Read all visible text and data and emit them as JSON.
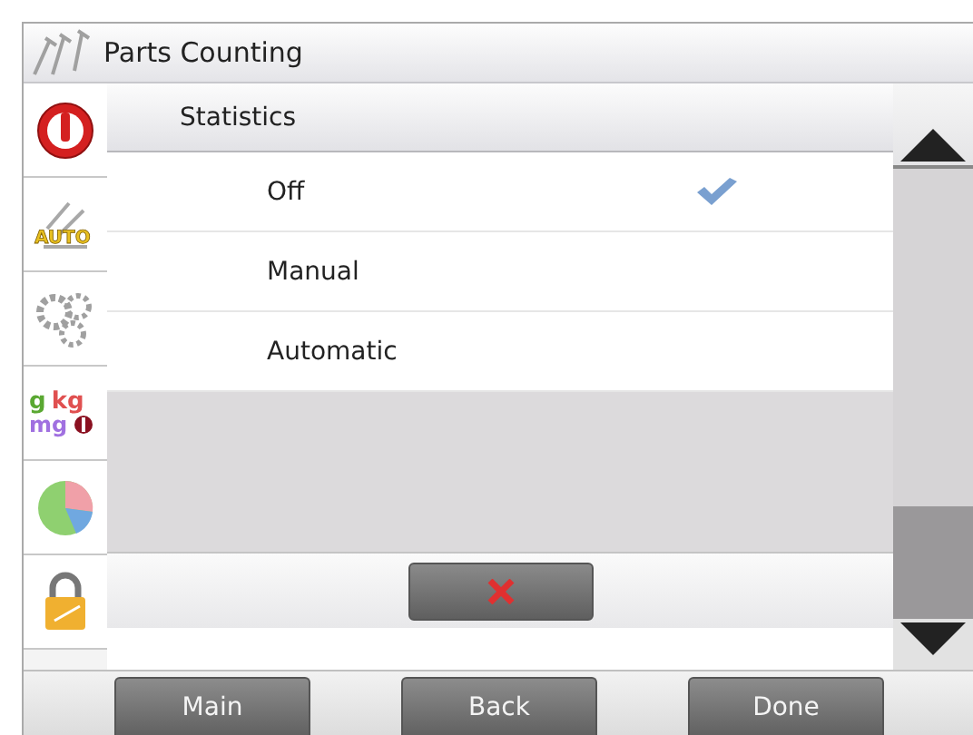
{
  "header": {
    "title": "Parts Counting"
  },
  "sidebar": {
    "items": [
      {
        "kind": "power"
      },
      {
        "kind": "auto",
        "label": "AUTO"
      },
      {
        "kind": "gears"
      },
      {
        "kind": "units",
        "labels": [
          "g",
          "kg",
          "mg"
        ]
      },
      {
        "kind": "pie"
      },
      {
        "kind": "lock"
      }
    ]
  },
  "dialog": {
    "title": "Statistics",
    "options": [
      {
        "label": "Off",
        "selected": true
      },
      {
        "label": "Manual",
        "selected": false
      },
      {
        "label": "Automatic",
        "selected": false
      }
    ]
  },
  "footer": {
    "buttons": [
      "Main",
      "Back",
      "Done"
    ]
  }
}
